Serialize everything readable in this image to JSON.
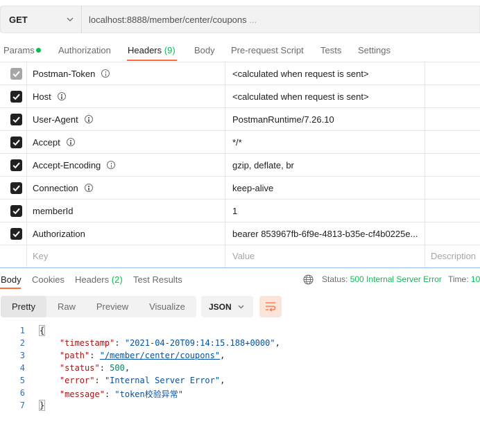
{
  "request": {
    "method": "GET",
    "url": "localhost:8888/member/center/coupons",
    "url_ellipsis": " ..."
  },
  "request_tabs": {
    "params": "Params",
    "authorization": "Authorization",
    "headers": "Headers",
    "headers_count": "(9)",
    "body": "Body",
    "prerequest": "Pre-request Script",
    "tests": "Tests",
    "settings": "Settings"
  },
  "headers": [
    {
      "key": "Postman-Token",
      "value": "<calculated when request is sent>",
      "checked": true,
      "disabled": true,
      "info": true
    },
    {
      "key": "Host",
      "value": "<calculated when request is sent>",
      "checked": true,
      "disabled": false,
      "info": true
    },
    {
      "key": "User-Agent",
      "value": "PostmanRuntime/7.26.10",
      "checked": true,
      "disabled": false,
      "info": true
    },
    {
      "key": "Accept",
      "value": "*/*",
      "checked": true,
      "disabled": false,
      "info": true
    },
    {
      "key": "Accept-Encoding",
      "value": "gzip, deflate, br",
      "checked": true,
      "disabled": false,
      "info": true
    },
    {
      "key": "Connection",
      "value": "keep-alive",
      "checked": true,
      "disabled": false,
      "info": true
    },
    {
      "key": "memberId",
      "value": "1",
      "checked": true,
      "disabled": false,
      "info": false
    },
    {
      "key": "Authorization",
      "value": "bearer 853967fb-6f9e-4813-b35e-cf4b0225e...",
      "checked": true,
      "disabled": false,
      "info": false
    }
  ],
  "headers_placeholder": {
    "key": "Key",
    "value": "Value",
    "description": "Description"
  },
  "response_tabs": {
    "body": "Body",
    "cookies": "Cookies",
    "headers": "Headers",
    "headers_count": "(2)",
    "test_results": "Test Results"
  },
  "status": {
    "label": "Status:",
    "value": "500 Internal Server Error",
    "time_label": "Time:",
    "time_value": "10"
  },
  "view_modes": {
    "pretty": "Pretty",
    "raw": "Raw",
    "preview": "Preview",
    "visualize": "Visualize",
    "active": "pretty"
  },
  "format": "JSON",
  "colors": {
    "accent": "#ff6c37",
    "success": "#0cbb52"
  },
  "icons": {
    "method_chevron": "chevron-down-icon",
    "info": "info-icon",
    "checkbox": "checkbox-checked-icon",
    "globe": "globe-icon",
    "wrap": "wrap-lines-icon"
  },
  "response_body": {
    "line_numbers": [
      "1",
      "2",
      "3",
      "4",
      "5",
      "6",
      "7"
    ],
    "open_brace": "{",
    "close_brace": "}",
    "fields": [
      {
        "key": "\"timestamp\"",
        "value": "\"2021-04-20T09:14:15.188+0000\"",
        "type": "string",
        "link": false
      },
      {
        "key": "\"path\"",
        "value": "\"/member/center/coupons\"",
        "type": "string",
        "link": true
      },
      {
        "key": "\"status\"",
        "value": "500",
        "type": "number",
        "link": false
      },
      {
        "key": "\"error\"",
        "value": "\"Internal Server Error\"",
        "type": "string",
        "link": false
      },
      {
        "key": "\"message\"",
        "value": "\"token校验异常\"",
        "type": "string",
        "link": false
      }
    ]
  }
}
